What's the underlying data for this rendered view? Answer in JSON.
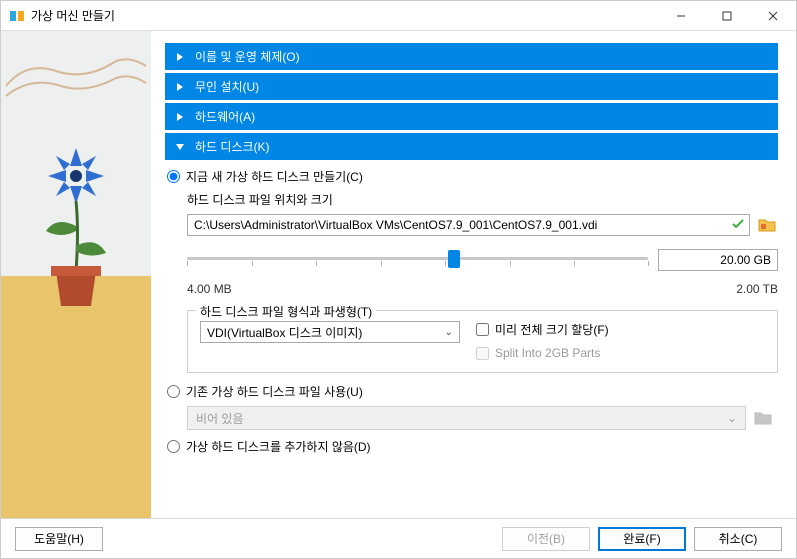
{
  "window": {
    "title": "가상 머신 만들기"
  },
  "accordion": {
    "name_os": "이름 및 운영 체제(O)",
    "unattended": "무인 설치(U)",
    "hardware": "하드웨어(A)",
    "harddisk": "하드 디스크(K)"
  },
  "harddisk": {
    "radio_create_new": "지금 새 가상 하드 디스크 만들기(C)",
    "file_location_label": "하드 디스크 파일 위치와 크기",
    "file_path": "C:\\Users\\Administrator\\VirtualBox VMs\\CentOS7.9_001\\CentOS7.9_001.vdi",
    "size_value": "20.00 GB",
    "slider_min_label": "4.00 MB",
    "slider_max_label": "2.00 TB",
    "format_group_label": "하드 디스크 파일 형식과 파생형(T)",
    "format_selected": "VDI(VirtualBox 디스크 이미지)",
    "preallocate_label": "미리 전체 크기 할당(F)",
    "split_label": "Split Into 2GB Parts",
    "radio_use_existing": "기존 가상 하드 디스크 파일 사용(U)",
    "existing_placeholder": "비어 있음",
    "radio_no_disk": "가상 하드 디스크를 추가하지 않음(D)"
  },
  "footer": {
    "help": "도움말(H)",
    "back": "이전(B)",
    "finish": "완료(F)",
    "cancel": "취소(C)"
  }
}
